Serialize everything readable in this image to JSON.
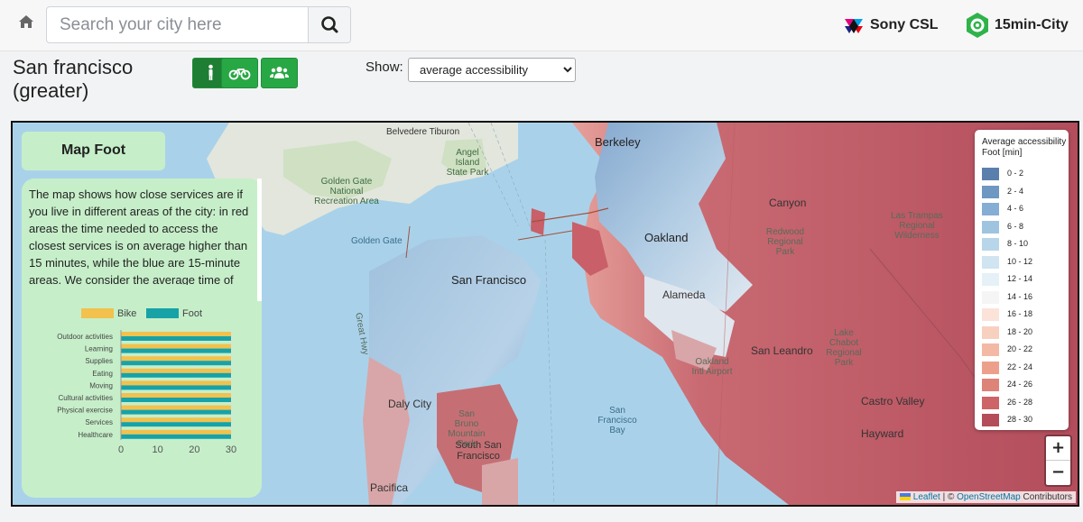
{
  "header": {
    "home_icon": "home-icon",
    "search_placeholder": "Search your city here",
    "search_icon": "search-icon",
    "logo_sony": "Sony CSL",
    "logo_15min": "15min-City"
  },
  "controls": {
    "city_line1": "San francisco",
    "city_line2": "(greater)",
    "mode_buttons": [
      {
        "icon": "walking-person-icon",
        "active": true
      },
      {
        "icon": "bicycle-icon",
        "active": false
      },
      {
        "icon": "users-icon",
        "active": false
      }
    ],
    "show_label": "Show:",
    "show_selected": "average accessibility"
  },
  "panel": {
    "title": "Map Foot",
    "description": "The map shows how close services are if you live in different areas of the city: in red areas the time needed to access the closest services is on average higher than 15 minutes, while the blue are 15-minute areas. We consider the average time of"
  },
  "chart_data": {
    "type": "bar",
    "orientation": "horizontal",
    "categories": [
      "Outdoor activities",
      "Learning",
      "Supplies",
      "Eating",
      "Moving",
      "Cultural activities",
      "Physical exercise",
      "Services",
      "Healthcare"
    ],
    "series": [
      {
        "name": "Bike",
        "color": "#f2c14e",
        "values": [
          30,
          30,
          30,
          30,
          30,
          30,
          30,
          30,
          30
        ]
      },
      {
        "name": "Foot",
        "color": "#17a2a8",
        "values": [
          30,
          30,
          30,
          30,
          30,
          30,
          30,
          30,
          30
        ]
      }
    ],
    "xticks": [
      "0",
      "10",
      "20",
      "30"
    ],
    "xlim": [
      0,
      30
    ],
    "legend": "top"
  },
  "legend": {
    "title_line1": "Average accessibility",
    "title_line2": "Foot [min]",
    "items": [
      {
        "label": "0 - 2",
        "color": "#5b7fad"
      },
      {
        "label": "2 - 4",
        "color": "#6e97c2"
      },
      {
        "label": "4 - 6",
        "color": "#86add3"
      },
      {
        "label": "6 - 8",
        "color": "#9fc4e0"
      },
      {
        "label": "8 - 10",
        "color": "#b8d6ea"
      },
      {
        "label": "10 - 12",
        "color": "#d0e4f1"
      },
      {
        "label": "12 - 14",
        "color": "#e6f0f7"
      },
      {
        "label": "14 - 16",
        "color": "#f5f5f5"
      },
      {
        "label": "16 - 18",
        "color": "#fbe3da"
      },
      {
        "label": "18 - 20",
        "color": "#f8d0c0"
      },
      {
        "label": "20 - 22",
        "color": "#f3b9a4"
      },
      {
        "label": "22 - 24",
        "color": "#eca08b"
      },
      {
        "label": "24 - 26",
        "color": "#dd8378"
      },
      {
        "label": "26 - 28",
        "color": "#cc6468"
      },
      {
        "label": "28 - 30",
        "color": "#b54c5a"
      }
    ]
  },
  "map": {
    "labels": {
      "berkeley": "Berkeley",
      "oakland": "Oakland",
      "alameda": "Alameda",
      "sf": "San Francisco",
      "daly": "Daly City",
      "tiburon": "Belvedere Tiburon",
      "golden_gate": "Golden Gate",
      "ggnra": "Golden Gate National Recreation Area",
      "angel": "Angel Island State Park",
      "canyon": "Canyon",
      "san_leandro": "San Leandro",
      "castro": "Castro Valley",
      "hayward": "Hayward",
      "sf_bay": "San Francisco Bay",
      "ssf": "South San Francisco",
      "pacifica": "Pacifica",
      "redwood": "Redwood Regional Park",
      "las_trampas": "Las Trampas Regional Wilderness",
      "lake_chabot": "Lake Chabot Regional Park",
      "oak_airport": "Oakland Intl Airport",
      "san_bruno": "San Bruno Mountain Park",
      "great_hwy": "Great Hwy"
    },
    "zoom_in": "+",
    "zoom_out": "−",
    "attribution_leaflet": "Leaflet",
    "attribution_sep": "| ©",
    "attribution_osm": "OpenStreetMap",
    "attribution_contrib": "Contributors"
  }
}
